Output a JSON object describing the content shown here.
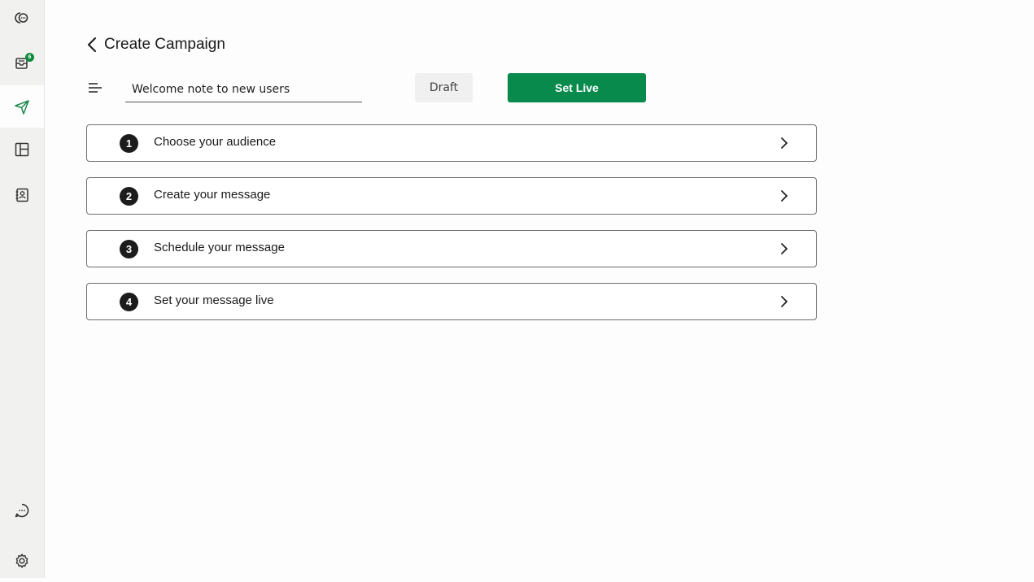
{
  "header": {
    "title": "Create Campaign"
  },
  "campaign": {
    "name_value": "Welcome note to new users",
    "draft_label": "Draft",
    "set_live_label": "Set Live"
  },
  "sidebar": {
    "inbox_badge": "6",
    "items": [
      {
        "name": "conversations",
        "icon": "chat-bubbles-icon"
      },
      {
        "name": "inbox",
        "icon": "inbox-icon"
      },
      {
        "name": "campaigns",
        "icon": "send-icon",
        "active": true
      },
      {
        "name": "layout",
        "icon": "layout-icon"
      },
      {
        "name": "contacts",
        "icon": "contacts-icon"
      },
      {
        "name": "chat",
        "icon": "chat-icon"
      },
      {
        "name": "settings",
        "icon": "gear-icon"
      }
    ]
  },
  "steps": [
    {
      "number": "1",
      "label": "Choose your audience"
    },
    {
      "number": "2",
      "label": "Create your message"
    },
    {
      "number": "3",
      "label": "Schedule your message"
    },
    {
      "number": "4",
      "label": "Set your message live"
    }
  ],
  "colors": {
    "accent": "#078a4c",
    "active_icon": "#1a8a4c",
    "badge": "#0c8a3c"
  }
}
